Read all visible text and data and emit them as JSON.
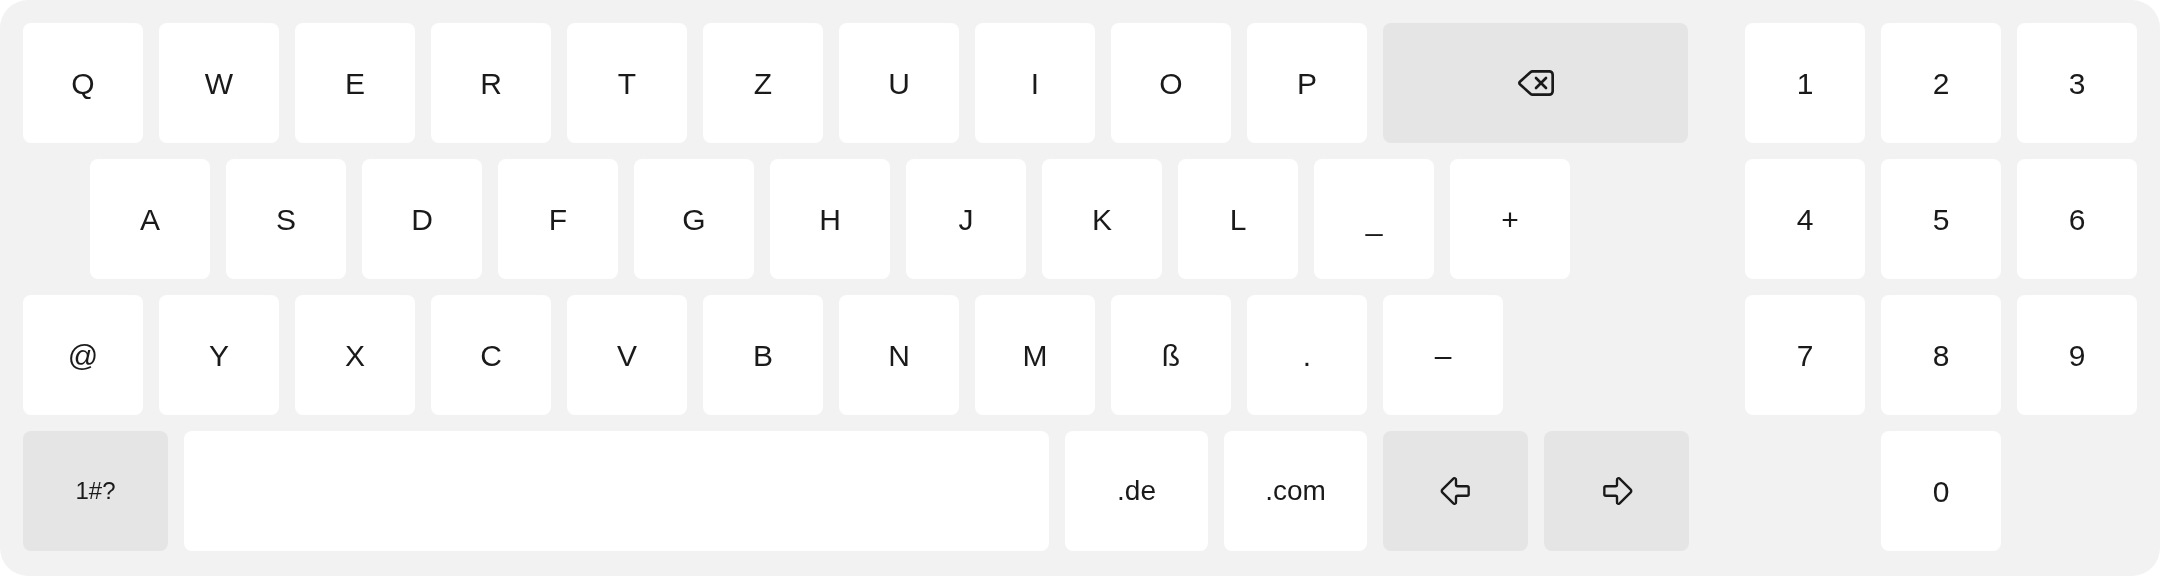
{
  "keyboard": {
    "rows": [
      {
        "keys": [
          {
            "kind": "char",
            "label": "Q"
          },
          {
            "kind": "char",
            "label": "W"
          },
          {
            "kind": "char",
            "label": "E"
          },
          {
            "kind": "char",
            "label": "R"
          },
          {
            "kind": "char",
            "label": "T"
          },
          {
            "kind": "char",
            "label": "Z"
          },
          {
            "kind": "char",
            "label": "U"
          },
          {
            "kind": "char",
            "label": "I"
          },
          {
            "kind": "char",
            "label": "O"
          },
          {
            "kind": "char",
            "label": "P"
          },
          {
            "kind": "backspace"
          }
        ]
      },
      {
        "keys": [
          {
            "kind": "char",
            "label": "A"
          },
          {
            "kind": "char",
            "label": "S"
          },
          {
            "kind": "char",
            "label": "D"
          },
          {
            "kind": "char",
            "label": "F"
          },
          {
            "kind": "char",
            "label": "G"
          },
          {
            "kind": "char",
            "label": "H"
          },
          {
            "kind": "char",
            "label": "J"
          },
          {
            "kind": "char",
            "label": "K"
          },
          {
            "kind": "char",
            "label": "L"
          },
          {
            "kind": "char",
            "label": "_"
          },
          {
            "kind": "char",
            "label": "+"
          }
        ]
      },
      {
        "keys": [
          {
            "kind": "char",
            "label": "@"
          },
          {
            "kind": "char",
            "label": "Y"
          },
          {
            "kind": "char",
            "label": "X"
          },
          {
            "kind": "char",
            "label": "C"
          },
          {
            "kind": "char",
            "label": "V"
          },
          {
            "kind": "char",
            "label": "B"
          },
          {
            "kind": "char",
            "label": "N"
          },
          {
            "kind": "char",
            "label": "M"
          },
          {
            "kind": "char",
            "label": "ß"
          },
          {
            "kind": "char",
            "label": "."
          },
          {
            "kind": "char",
            "label": "–"
          }
        ]
      },
      {
        "keys": [
          {
            "kind": "mode",
            "label": "1#?"
          },
          {
            "kind": "space"
          },
          {
            "kind": "domain",
            "label": ".de"
          },
          {
            "kind": "domain",
            "label": ".com"
          },
          {
            "kind": "left"
          },
          {
            "kind": "right"
          }
        ]
      }
    ]
  },
  "numpad": {
    "rows": [
      [
        "1",
        "2",
        "3"
      ],
      [
        "4",
        "5",
        "6"
      ],
      [
        "7",
        "8",
        "9"
      ],
      [
        "",
        "0"
      ]
    ]
  }
}
